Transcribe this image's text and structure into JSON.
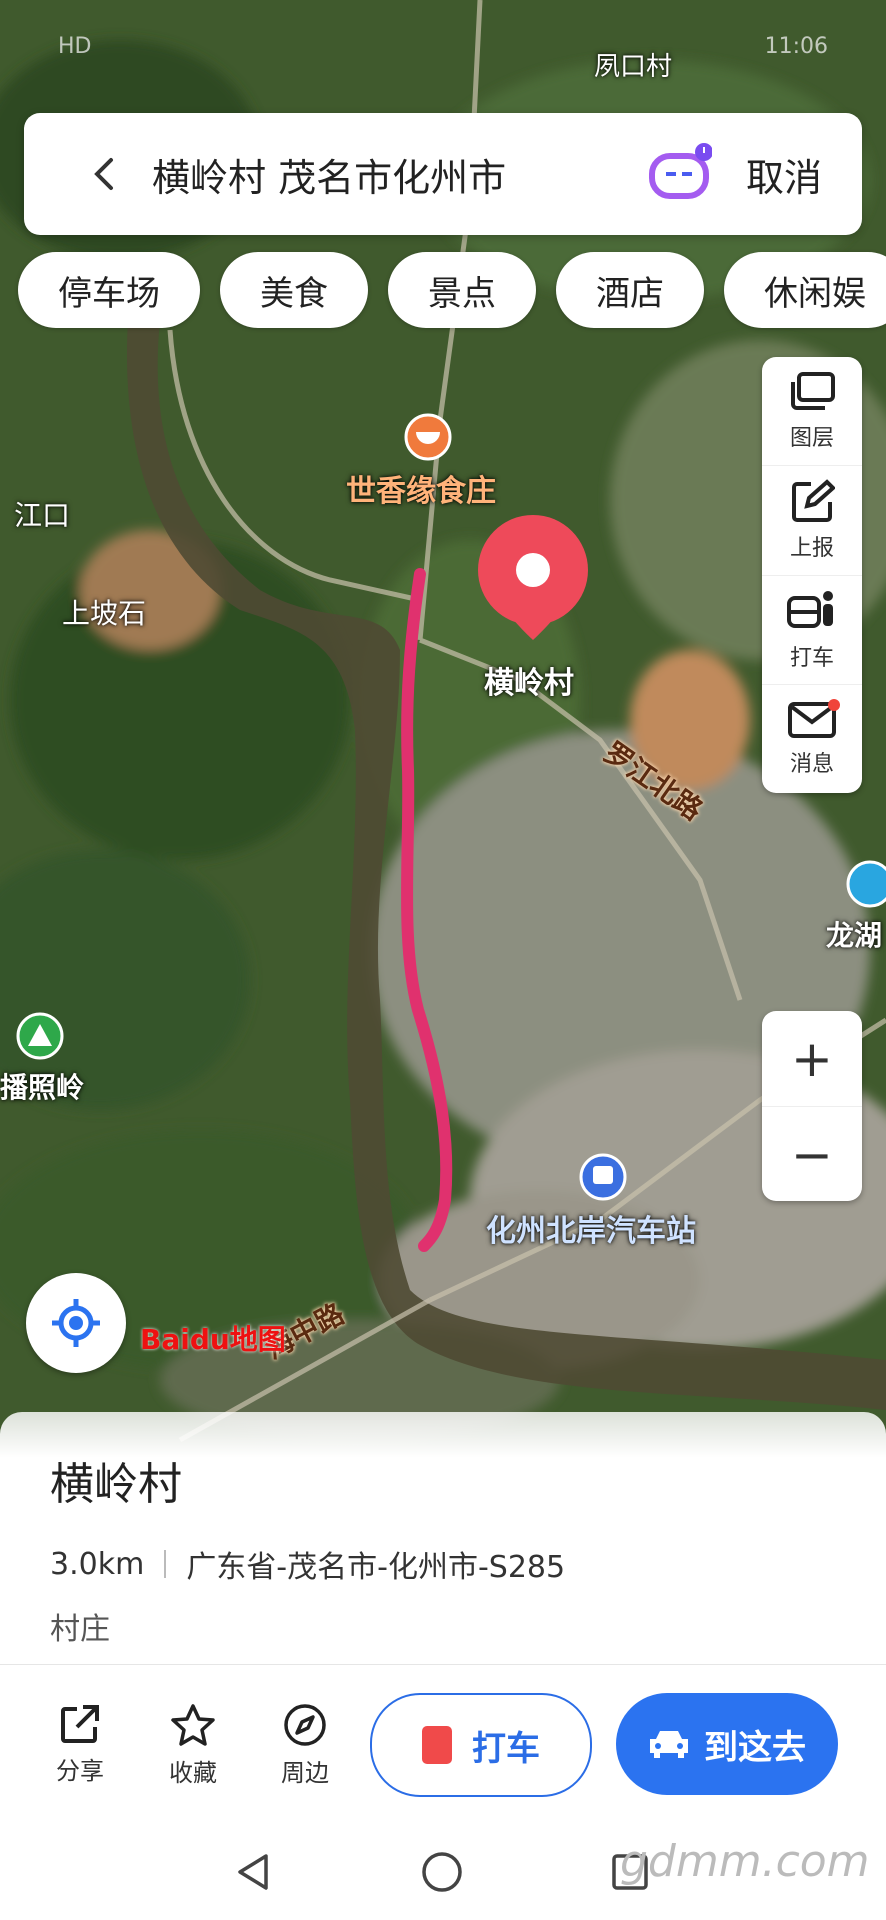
{
  "status_bar": {
    "carrier": "HD",
    "time": "11:06"
  },
  "search": {
    "query": "横岭村 茂名市化州市",
    "cancel_label": "取消"
  },
  "chips": [
    "停车场",
    "美食",
    "景点",
    "酒店",
    "休闲娱"
  ],
  "tools": [
    {
      "label": "图层",
      "icon": "layers-icon"
    },
    {
      "label": "上报",
      "icon": "report-edit-icon"
    },
    {
      "label": "打车",
      "icon": "taxi-person-icon"
    },
    {
      "label": "消息",
      "icon": "mail-icon"
    }
  ],
  "zoom": {
    "in": "+",
    "out": "−"
  },
  "map_labels": {
    "top_village": "夙口村",
    "restaurant": "世香缘食庄",
    "jiangkou": "江口",
    "shangposhi": "上坡石",
    "marker": "横岭村",
    "road_north": "罗江北路",
    "longhu": "龙湖",
    "panzhaoling": "播照岭",
    "bus_station": "化州北岸汽车站",
    "road_south": "海中路"
  },
  "baidu_logo": "Baidu地图",
  "place": {
    "name": "横岭村",
    "distance": "3.0km",
    "address": "广东省-茂名市-化州市-S285",
    "type": "村庄"
  },
  "actions": {
    "share": "分享",
    "favorite": "收藏",
    "nearby": "周边",
    "taxi": "打车",
    "go_here": "到这去"
  },
  "watermark": "gdmm.com",
  "colors": {
    "accent": "#2b73f0",
    "route": "#e0316e",
    "marker": "#ee4a5a"
  }
}
